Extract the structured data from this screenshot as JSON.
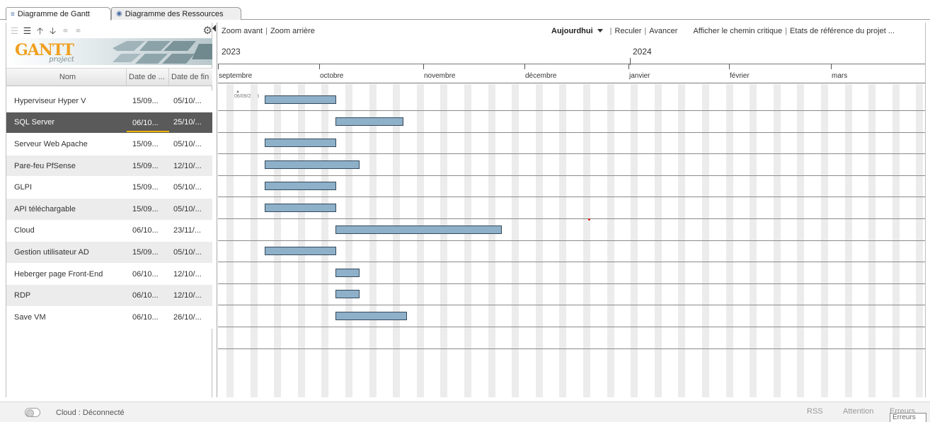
{
  "tabs": [
    {
      "label": "Diagramme de Gantt",
      "icon": "gantt-icon",
      "active": true
    },
    {
      "label": "Diagramme des Ressources",
      "icon": "resources-icon",
      "active": false
    }
  ],
  "left_toolbar": {
    "icons": [
      "unindent-icon",
      "indent-icon",
      "move-up-icon",
      "move-down-icon",
      "link-icon",
      "unlink-icon"
    ],
    "settings_icon": "gear-icon"
  },
  "logo": {
    "word": "GANTT",
    "sub": "project"
  },
  "columns": {
    "name": "Nom",
    "start": "Date de ...",
    "end": "Date de fin"
  },
  "tasks": [
    {
      "name": "Hyperviseur Hyper V",
      "start": "15/09...",
      "end": "05/10/..."
    },
    {
      "name": "SQL Server",
      "start": "06/10...",
      "end": "25/10/...",
      "selected": true
    },
    {
      "name": "Serveur Web Apache",
      "start": "15/09...",
      "end": "05/10/..."
    },
    {
      "name": "Pare-feu PfSense",
      "start": "15/09...",
      "end": "12/10/..."
    },
    {
      "name": "GLPI",
      "start": "15/09...",
      "end": "05/10/..."
    },
    {
      "name": "API téléchargable",
      "start": "15/09...",
      "end": "05/10/..."
    },
    {
      "name": "Cloud",
      "start": "06/10...",
      "end": "23/11/..."
    },
    {
      "name": "Gestion utilisateur AD",
      "start": "15/09...",
      "end": "05/10/..."
    },
    {
      "name": "Heberger page Front-End",
      "start": "06/10...",
      "end": "12/10/..."
    },
    {
      "name": "RDP",
      "start": "06/10...",
      "end": "12/10/..."
    },
    {
      "name": "Save VM",
      "start": "06/10...",
      "end": "26/10/..."
    }
  ],
  "chart_toolbar": {
    "zoom_in": "Zoom avant",
    "zoom_out": "Zoom arrière",
    "today": "Aujourdhui",
    "back": "Reculer",
    "forward": "Avancer",
    "critical_path": "Afficher le chemin critique",
    "baselines": "Etats de référence du projet ..."
  },
  "timeline": {
    "years": [
      "2023",
      "2024"
    ],
    "months": [
      "septembre",
      "octobre",
      "novembre",
      "décembre",
      "janvier",
      "février",
      "mars"
    ],
    "first_bar_label": "06/09/2023"
  },
  "statusbar": {
    "cloud_status": "Cloud : Déconnecté",
    "rss": "RSS",
    "attention": "Attention",
    "errors_link": "Erreurs",
    "errors_box": "Erreurs"
  },
  "colors": {
    "bar_fill": "#8eb0c8",
    "bar_border": "#334a5c",
    "selected_row": "#5a5a5a",
    "logo_accent": "#f0a020"
  }
}
